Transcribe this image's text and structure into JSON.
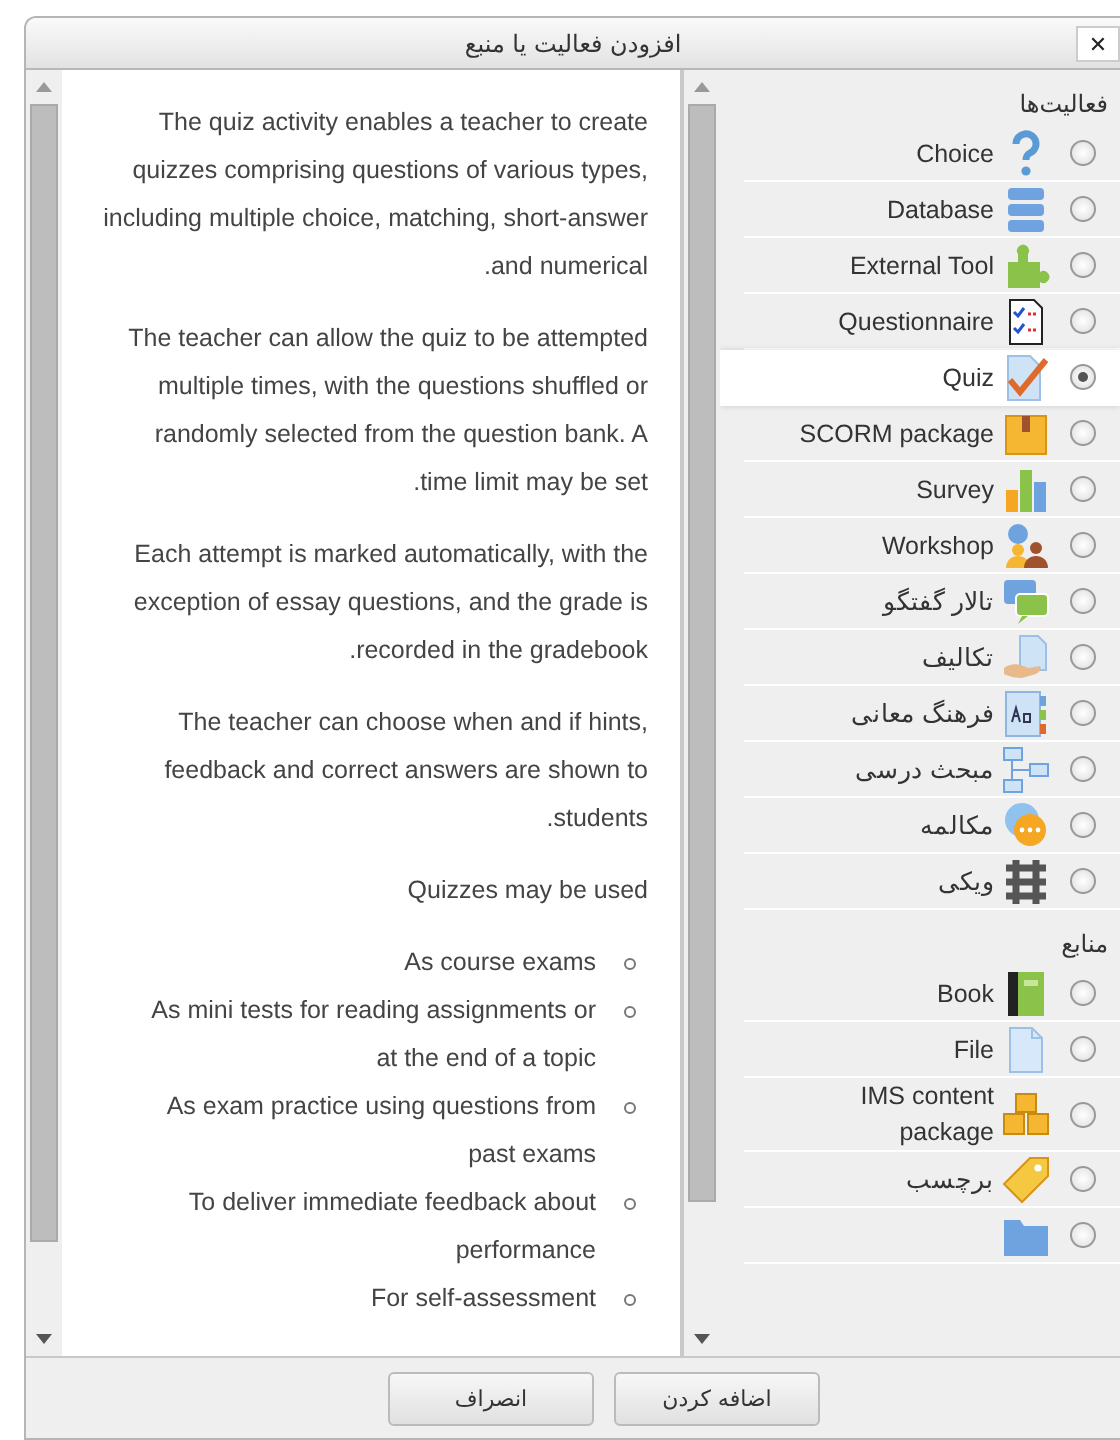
{
  "dialog": {
    "title": "افزودن فعالیت یا منبع",
    "close": "✕"
  },
  "chooser": {
    "sections": [
      {
        "heading": "فعالیت‌ها",
        "items": [
          {
            "label": "Choice",
            "kind": "question",
            "selected": false
          },
          {
            "label": "Database",
            "kind": "database",
            "selected": false
          },
          {
            "label": "External Tool",
            "kind": "puzzle",
            "selected": false
          },
          {
            "label": "Questionnaire",
            "kind": "checklist",
            "selected": false
          },
          {
            "label": "Quiz",
            "kind": "quiz",
            "selected": true
          },
          {
            "label": "SCORM package",
            "kind": "box",
            "selected": false
          },
          {
            "label": "Survey",
            "kind": "bars",
            "selected": false
          },
          {
            "label": "Workshop",
            "kind": "people",
            "selected": false
          },
          {
            "label": "تالار گفتگو",
            "kind": "forum",
            "selected": false
          },
          {
            "label": "تکالیف",
            "kind": "assign",
            "selected": false
          },
          {
            "label": "فرهنگ معانی",
            "kind": "glossary",
            "selected": false
          },
          {
            "label": "مبحث درسی",
            "kind": "lesson",
            "selected": false
          },
          {
            "label": "مکالمه",
            "kind": "chat",
            "selected": false
          },
          {
            "label": "ویکی",
            "kind": "wiki",
            "selected": false
          }
        ]
      },
      {
        "heading": "منابع",
        "items": [
          {
            "label": "Book",
            "kind": "book",
            "selected": false
          },
          {
            "label": "File",
            "kind": "file",
            "selected": false
          },
          {
            "label": "IMS content package",
            "kind": "ims",
            "selected": false
          },
          {
            "label": "برچسب",
            "kind": "tag",
            "selected": false
          },
          {
            "kind": "folder",
            "selected": false
          }
        ]
      }
    ]
  },
  "description": {
    "paragraphs": [
      "The quiz activity enables a teacher to create quizzes comprising questions of various types, including multiple choice, matching, short-answer and numerical.",
      "The teacher can allow the quiz to be attempted multiple times, with the questions shuffled or randomly selected from the question bank. A time limit may be set.",
      "Each attempt is marked automatically, with the exception of essay questions, and the grade is recorded in the gradebook.",
      "The teacher can choose when and if hints, feedback and correct answers are shown to students.",
      "Quizzes may be used"
    ],
    "uses": [
      "As course exams",
      "As mini tests for reading assignments or at the end of a topic",
      "As exam practice using questions from past exams",
      "To deliver immediate feedback about performance",
      "For self-assessment"
    ]
  },
  "buttons": [
    {
      "label": "اضافه کردن"
    },
    {
      "label": "انصراف"
    }
  ]
}
